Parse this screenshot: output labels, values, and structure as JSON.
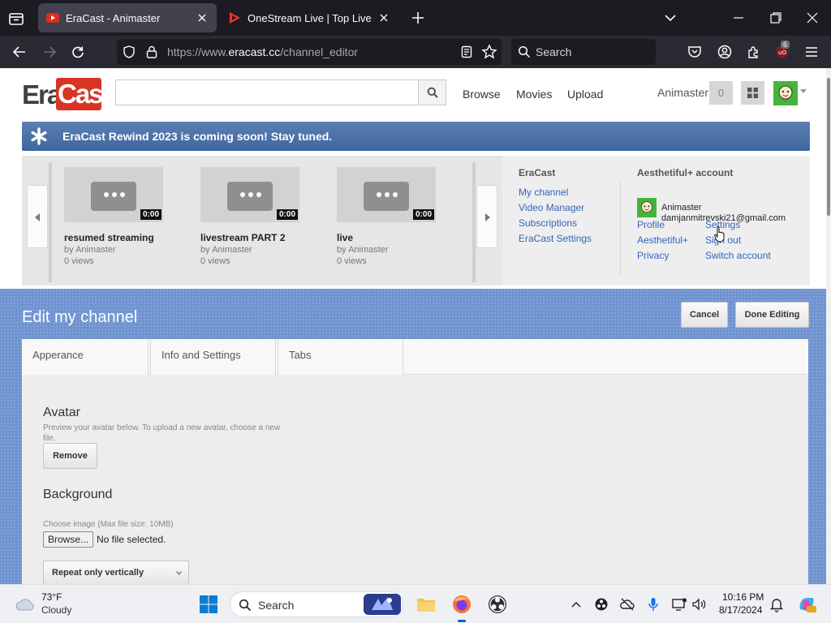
{
  "browser": {
    "tabs": [
      {
        "title": "EraCast - Animaster",
        "active": true
      },
      {
        "title": "OneStream Live | Top Live Strea",
        "active": false
      }
    ],
    "url_prefix": "https://www.",
    "url_domain": "eracast.cc",
    "url_path": "/channel_editor",
    "search_placeholder": "Search",
    "extension_badge": "6"
  },
  "site": {
    "logo_left": "Era",
    "logo_right": "Cast",
    "nav": {
      "browse": "Browse",
      "movies": "Movies",
      "upload": "Upload"
    },
    "username": "Animaster",
    "notifications": "0",
    "banner": "EraCast Rewind 2023 is coming soon! Stay tuned."
  },
  "guide": {
    "videos": [
      {
        "title": "resumed streaming",
        "by": "by Animaster",
        "views": "0 views",
        "duration": "0:00"
      },
      {
        "title": "livestream PART 2",
        "by": "by Animaster",
        "views": "0 views",
        "duration": "0:00"
      },
      {
        "title": "live",
        "by": "by Animaster",
        "views": "0 views",
        "duration": "0:00"
      }
    ],
    "eracast_menu": {
      "heading": "EraCast",
      "links": [
        "My channel",
        "Video Manager",
        "Subscriptions",
        "EraCast Settings"
      ]
    },
    "account": {
      "heading": "Aesthetiful+ account",
      "name": "Animaster",
      "email": "damjanmitrevski21@gmail.com",
      "links_left": [
        "Profile",
        "Aesthetiful+",
        "Privacy"
      ],
      "links_right": [
        "Settings",
        "Sign out",
        "Switch account"
      ]
    }
  },
  "editor": {
    "title": "Edit my channel",
    "cancel": "Cancel",
    "done": "Done Editing",
    "tabs": [
      "Apperance",
      "Info and Settings",
      "Tabs"
    ],
    "avatar_heading": "Avatar",
    "avatar_help": "Preview your avatar below. To upload a new avatar, choose a new file.",
    "remove": "Remove",
    "background_heading": "Background",
    "choose_image": "Choose image (Max file size: 10MB)",
    "browse": "Browse...",
    "no_file": "No file selected.",
    "repeat_select": "Repeat only vertically"
  },
  "taskbar": {
    "temp": "73°F",
    "condition": "Cloudy",
    "search_placeholder": "Search",
    "time": "10:16 PM",
    "date": "8/17/2024"
  },
  "colors": {
    "banner": "#4a70a8",
    "logo_red": "#d83424",
    "link": "#3366bb",
    "editor_bg": "#6f93cf"
  }
}
